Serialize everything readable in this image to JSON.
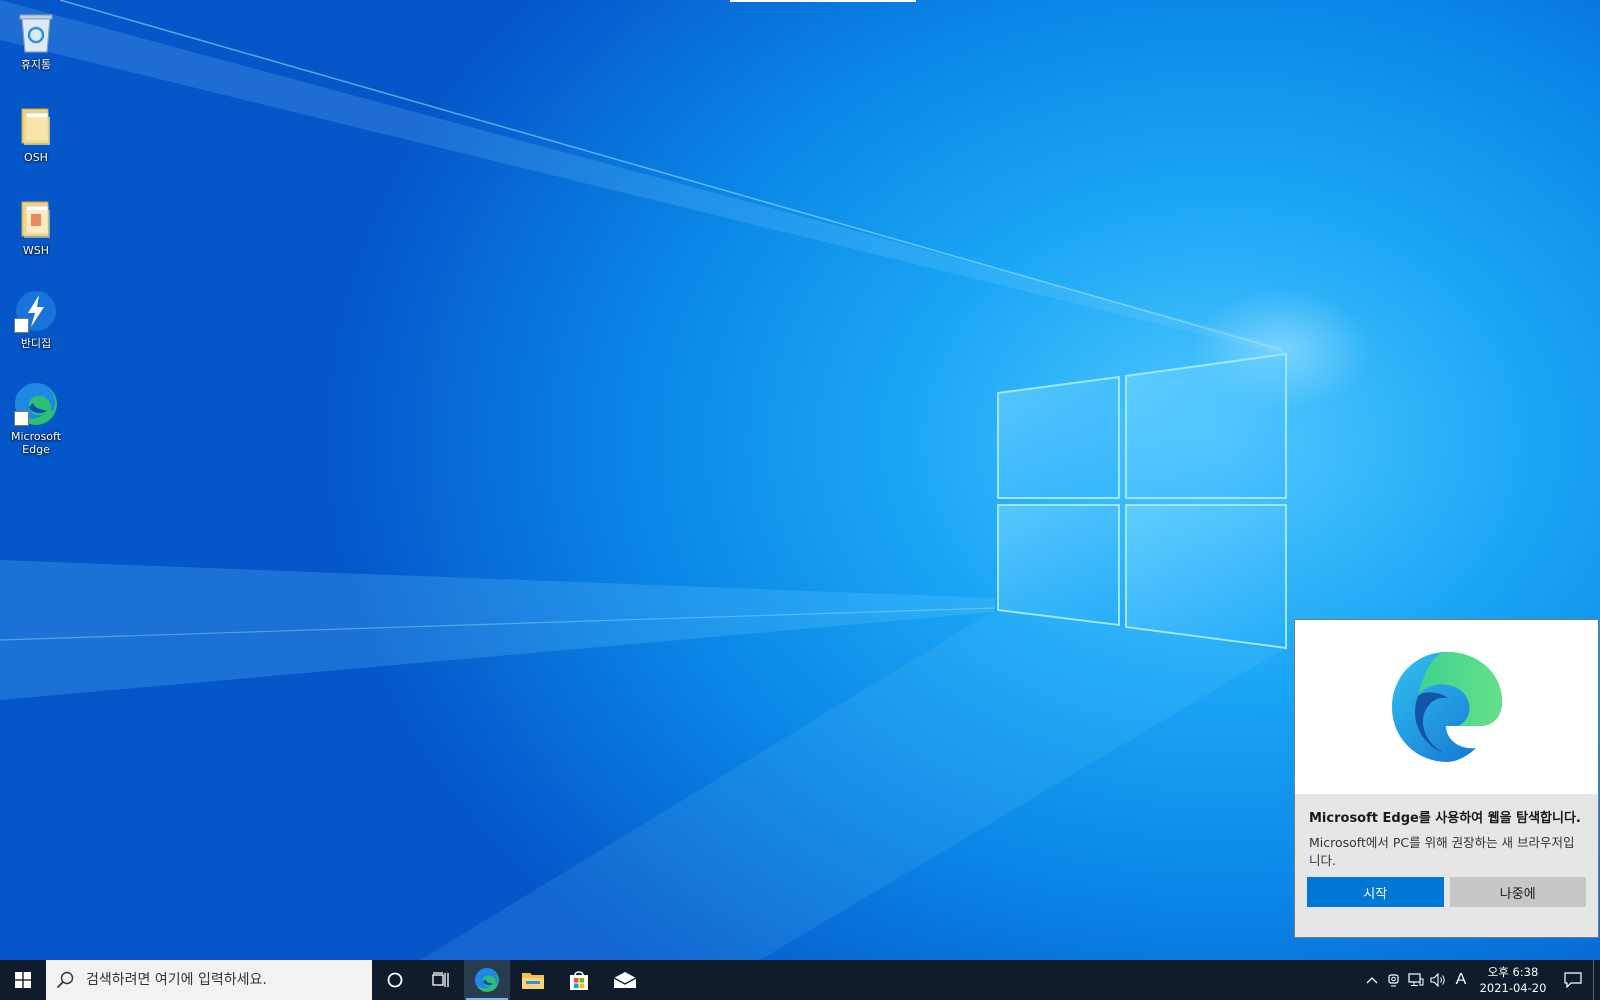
{
  "desktop": {
    "icons": [
      {
        "label": "휴지통",
        "icon": "recycle-bin-icon"
      },
      {
        "label": "OSH",
        "icon": "folder-icon"
      },
      {
        "label": "WSH",
        "icon": "folder-icon"
      },
      {
        "label": "반디집",
        "icon": "bandizip-icon"
      },
      {
        "label": "Microsoft Edge",
        "icon": "edge-icon"
      }
    ]
  },
  "toast": {
    "app_icon": "edge-icon",
    "title": "Microsoft  Edge를 사용하여 웹을 탐색합니다.",
    "body": "Microsoft에서 PC를 위해 권장하는 새 브라우저입니다.",
    "primary_label": "시작",
    "secondary_label": "나중에"
  },
  "taskbar": {
    "start_icon": "windows-start-icon",
    "search_placeholder": "검색하려면 여기에 입력하세요.",
    "pinned": [
      {
        "name": "cortana",
        "icon": "cortana-circle-icon"
      },
      {
        "name": "task-view",
        "icon": "task-view-icon"
      },
      {
        "name": "edge",
        "icon": "edge-icon",
        "active": true
      },
      {
        "name": "file-explorer",
        "icon": "file-explorer-icon"
      },
      {
        "name": "store",
        "icon": "store-icon"
      },
      {
        "name": "mail",
        "icon": "mail-icon"
      }
    ],
    "tray": {
      "ime": "A",
      "time": "오후 6:38",
      "date": "2021-04-20"
    }
  },
  "colors": {
    "accent": "#0078d7",
    "taskbar": "#101c2c",
    "toast_bg": "#e6e6e6"
  }
}
